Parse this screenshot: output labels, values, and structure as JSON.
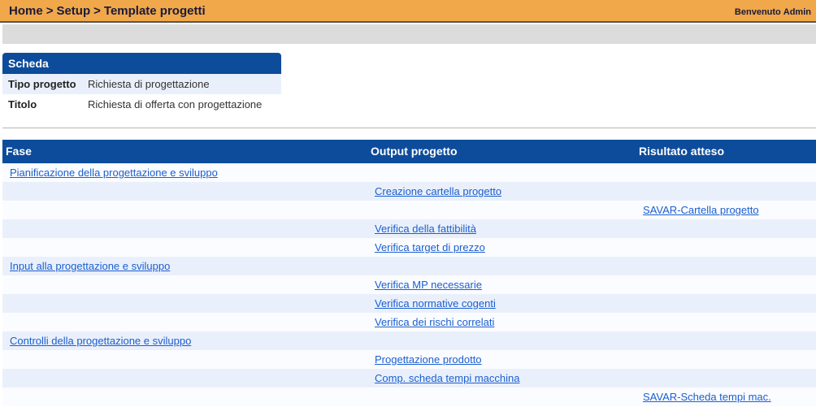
{
  "header": {
    "breadcrumb": [
      "Home",
      "Setup",
      "Template progetti"
    ],
    "separator": ">",
    "welcome_label": "Benvenuto",
    "user": "Admin"
  },
  "colors": {
    "topbar": "#f0a84a",
    "header_blue": "#0d4c9b",
    "row_alt": "#eaf0fb",
    "link": "#1a5fd0"
  },
  "scheda": {
    "title": "Scheda",
    "fields": [
      {
        "label": "Tipo progetto",
        "value": "Richiesta di progettazione"
      },
      {
        "label": "Titolo",
        "value": "Richiesta di offerta con progettazione"
      }
    ]
  },
  "table": {
    "columns": [
      "Fase",
      "Output progetto",
      "Risultato atteso"
    ],
    "rows": [
      {
        "fase": "Pianificazione della progettazione e sviluppo",
        "output": "",
        "risultato": ""
      },
      {
        "fase": "",
        "output": "Creazione cartella progetto",
        "risultato": ""
      },
      {
        "fase": "",
        "output": "",
        "risultato": "SAVAR-Cartella progetto"
      },
      {
        "fase": "",
        "output": "Verifica della fattibilità",
        "risultato": ""
      },
      {
        "fase": "",
        "output": "Verifica target di prezzo",
        "risultato": ""
      },
      {
        "fase": "Input alla progettazione e sviluppo",
        "output": "",
        "risultato": ""
      },
      {
        "fase": "",
        "output": "Verifica MP necessarie",
        "risultato": ""
      },
      {
        "fase": "",
        "output": "Verifica normative cogenti",
        "risultato": ""
      },
      {
        "fase": "",
        "output": "Verifica dei rischi correlati",
        "risultato": ""
      },
      {
        "fase": "Controlli della progettazione e sviluppo",
        "output": "",
        "risultato": ""
      },
      {
        "fase": "",
        "output": "Progettazione prodotto",
        "risultato": ""
      },
      {
        "fase": "",
        "output": "Comp. scheda tempi macchina",
        "risultato": ""
      },
      {
        "fase": "",
        "output": "",
        "risultato": "SAVAR-Scheda tempi mac."
      }
    ]
  }
}
